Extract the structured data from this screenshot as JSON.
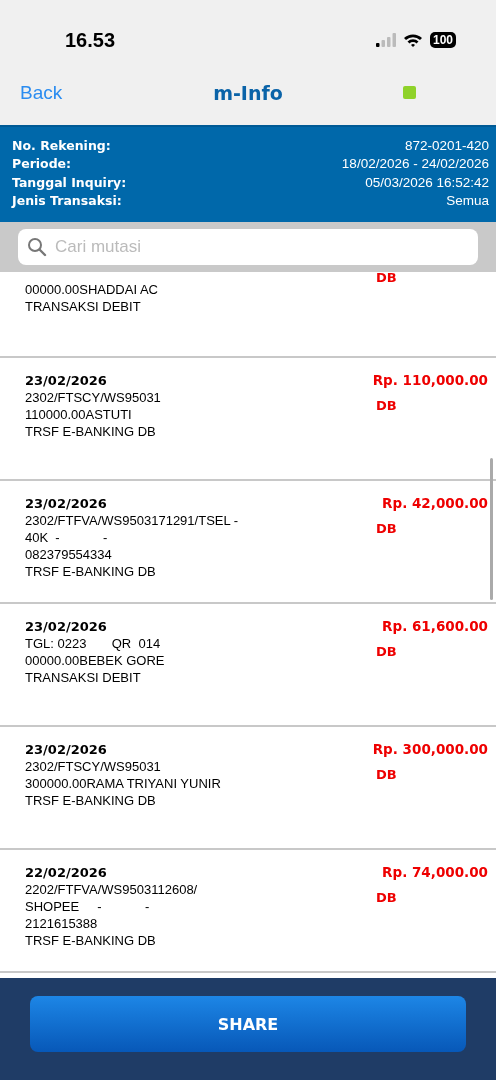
{
  "status_bar": {
    "time": "16.53",
    "battery": "100"
  },
  "nav": {
    "back": "Back",
    "title": "m-Info"
  },
  "account_info": [
    {
      "label": "No. Rekening:",
      "value": "872-0201-420"
    },
    {
      "label": "Periode:",
      "value": "18/02/2026 - 24/02/2026"
    },
    {
      "label": "Tanggal Inquiry:",
      "value": "05/03/2026 16:52:42"
    },
    {
      "label": "Jenis Transaksi:",
      "value": "Semua"
    }
  ],
  "search": {
    "placeholder": "Cari mutasi"
  },
  "transactions": [
    {
      "kind": "partial",
      "lines": [
        "00000.00SHADDAI AC",
        "TRANSAKSI DEBIT"
      ],
      "type": "DB"
    },
    {
      "kind": "full",
      "date": "23/02/2026",
      "lines": [
        "2302/FTSCY/WS95031",
        "110000.00ASTUTI",
        "TRSF E-BANKING DB"
      ],
      "amount": "Rp. 110,000.00",
      "type": "DB"
    },
    {
      "kind": "full",
      "date": "23/02/2026",
      "lines": [
        "2302/FTFVA/WS9503171291/TSEL -",
        "40K  -            -",
        "082379554334",
        "TRSF E-BANKING DB"
      ],
      "amount": "Rp. 42,000.00",
      "type": "DB"
    },
    {
      "kind": "full",
      "date": "23/02/2026",
      "lines": [
        "TGL: 0223       QR  014",
        "00000.00BEBEK GORE",
        "TRANSAKSI DEBIT"
      ],
      "amount": "Rp. 61,600.00",
      "type": "DB"
    },
    {
      "kind": "full",
      "date": "23/02/2026",
      "lines": [
        "2302/FTSCY/WS95031",
        "300000.00RAMA TRIYANI YUNIR",
        "TRSF E-BANKING DB"
      ],
      "amount": "Rp. 300,000.00",
      "type": "DB"
    },
    {
      "kind": "full",
      "date": "22/02/2026",
      "lines": [
        "2202/FTFVA/WS9503112608/",
        "SHOPEE     -            -",
        "2121615388",
        "TRSF E-BANKING DB"
      ],
      "amount": "Rp. 74,000.00",
      "type": "DB"
    }
  ],
  "share_button": "SHARE"
}
